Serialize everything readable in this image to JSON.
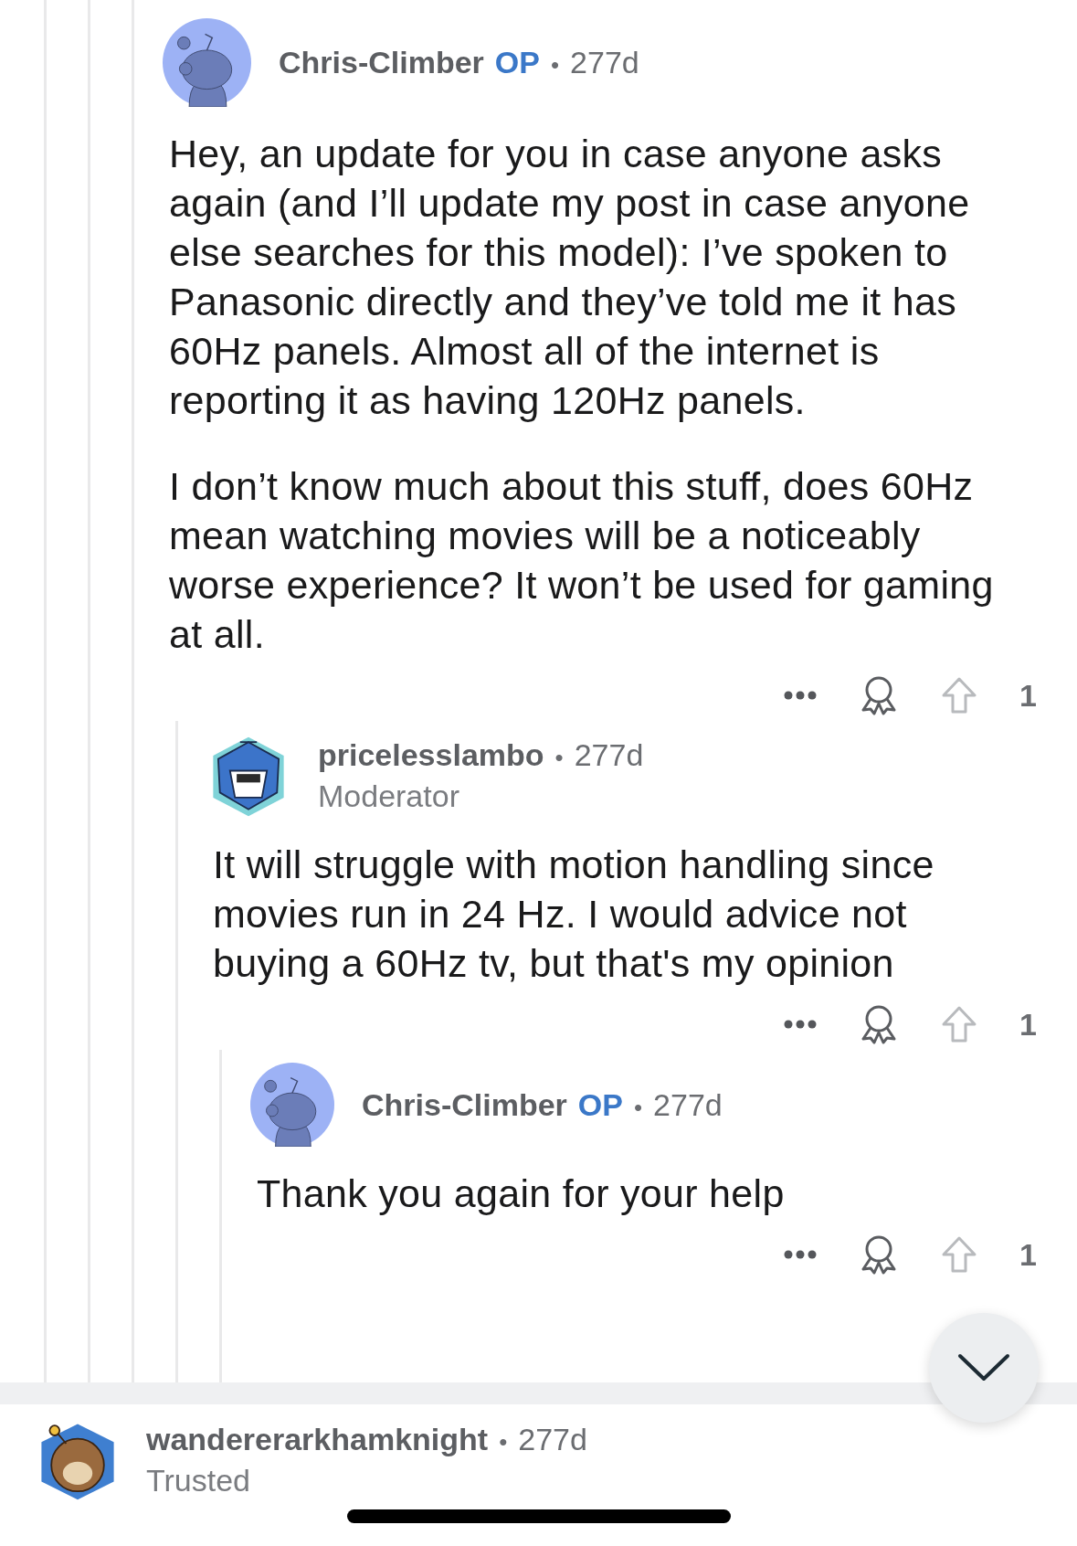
{
  "comments": [
    {
      "author": "Chris-Climber",
      "badge": "OP",
      "bullet": "•",
      "time": "277d",
      "avatar": {
        "kind": "snoo"
      },
      "paragraphs": [
        "Hey, an update for you in case anyone asks again (and I’ll update my post in case anyone else searches for this model): I’ve spoken to Panasonic directly and they’ve told me it has 60Hz panels. Almost all of the internet is reporting it as having 120Hz panels.",
        "I don’t know much about this stuff, does 60Hz mean watching movies will be a noticeably worse experience? It won’t be used for gaming at all."
      ],
      "upvotes": "1",
      "children": [
        {
          "author": "pricelesslambo",
          "bullet": "•",
          "time": "277d",
          "flair": "Moderator",
          "avatar": {
            "kind": "robot"
          },
          "paragraphs": [
            "It will struggle with motion handling since movies run in 24 Hz. I would advice not buying a 60Hz tv, but that's my opinion"
          ],
          "upvotes": "1",
          "children": [
            {
              "author": "Chris-Climber",
              "badge": "OP",
              "bullet": "•",
              "time": "277d",
              "avatar": {
                "kind": "snoo"
              },
              "paragraphs": [
                "Thank you again for your help"
              ],
              "upvotes": "1"
            }
          ]
        }
      ]
    }
  ],
  "next_comment": {
    "author": "wandererarkhamknight",
    "bullet": "•",
    "time": "277d",
    "flair": "Trusted",
    "avatar": {
      "kind": "owl"
    }
  }
}
